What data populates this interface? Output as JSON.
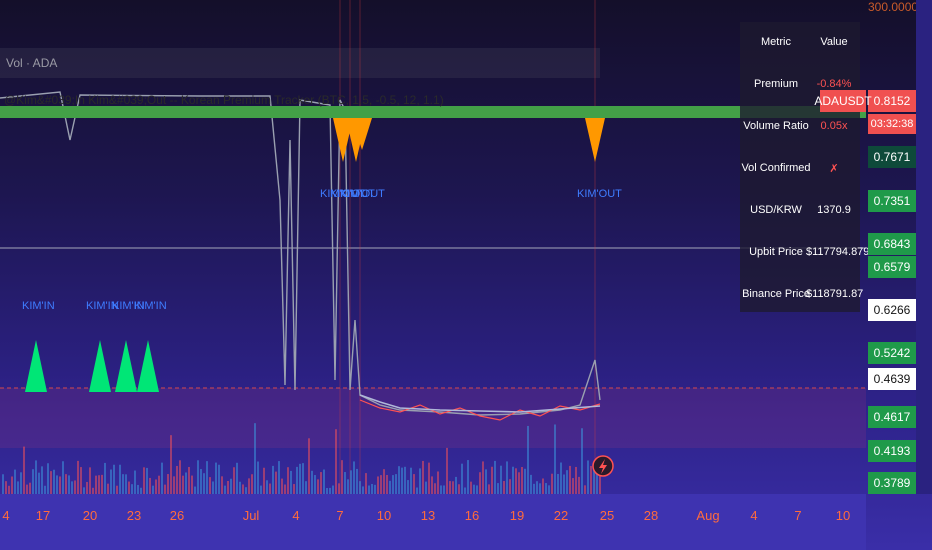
{
  "indicator_title": "@Kim&#039;In Kim&#039;Out -- Korean Premium Tracker (BTC, 1.5, -0.5, 12, 1.1)",
  "volume_label": "Vol · ADA",
  "price_axis_top": "300.0000",
  "symbol": "ADAUSDT",
  "timer": "03:32:38",
  "table": {
    "headers": [
      "Metric",
      "Value"
    ],
    "rows": [
      {
        "metric": "Premium",
        "value": "-0.84%"
      },
      {
        "metric": "Volume Ratio",
        "value": "0.05x"
      },
      {
        "metric": "Vol Confirmed",
        "value": "✗"
      },
      {
        "metric": "USD/KRW",
        "value": "1370.9"
      },
      {
        "metric": "Upbit Price",
        "value": "$117794.8793"
      },
      {
        "metric": "Binance Price",
        "value": "$118791.87"
      }
    ]
  },
  "price_levels": [
    {
      "text": "0.8152",
      "bg": "#f05050",
      "fg": "#ffffff"
    },
    {
      "text": "0.7671",
      "bg": "#0e4a3a",
      "fg": "#ffffff"
    },
    {
      "text": "0.7351",
      "bg": "#1f9a4a",
      "fg": "#ffffff"
    },
    {
      "text": "0.6843",
      "bg": "#1f9a4a",
      "fg": "#ffffff"
    },
    {
      "text": "0.6579",
      "bg": "#1f9a4a",
      "fg": "#ffffff"
    },
    {
      "text": "0.6266",
      "bg": "#ffffff",
      "fg": "#131313"
    },
    {
      "text": "0.5242",
      "bg": "#1f9a4a",
      "fg": "#ffffff"
    },
    {
      "text": "0.4639",
      "bg": "#ffffff",
      "fg": "#131313"
    },
    {
      "text": "0.4617",
      "bg": "#1f9a4a",
      "fg": "#ffffff"
    },
    {
      "text": "0.4193",
      "bg": "#1f9a4a",
      "fg": "#ffffff"
    },
    {
      "text": "0.3789",
      "bg": "#1f9a4a",
      "fg": "#ffffff"
    }
  ],
  "x_axis": [
    "4",
    "17",
    "20",
    "23",
    "26",
    "Jul",
    "4",
    "7",
    "10",
    "13",
    "16",
    "19",
    "22",
    "25",
    "28",
    "Aug",
    "4",
    "7",
    "10"
  ],
  "signals": {
    "kim_in": [
      "KIM'IN",
      "KIM'IN",
      "KIM'IN",
      "KIM'IN"
    ],
    "kim_out": [
      "KIM'OUT",
      "KIM'OUT",
      "KIM'OUT",
      "KIM'OUT"
    ]
  },
  "colors": {
    "buy_marker": "#00e676",
    "sell_marker": "#ff9800",
    "signal_band": "#43a047",
    "premium_line": "#ff5252",
    "ma_line": "#b0b8d8",
    "label_blue": "#3f7cff"
  },
  "icons": [
    "lightning-icon"
  ]
}
